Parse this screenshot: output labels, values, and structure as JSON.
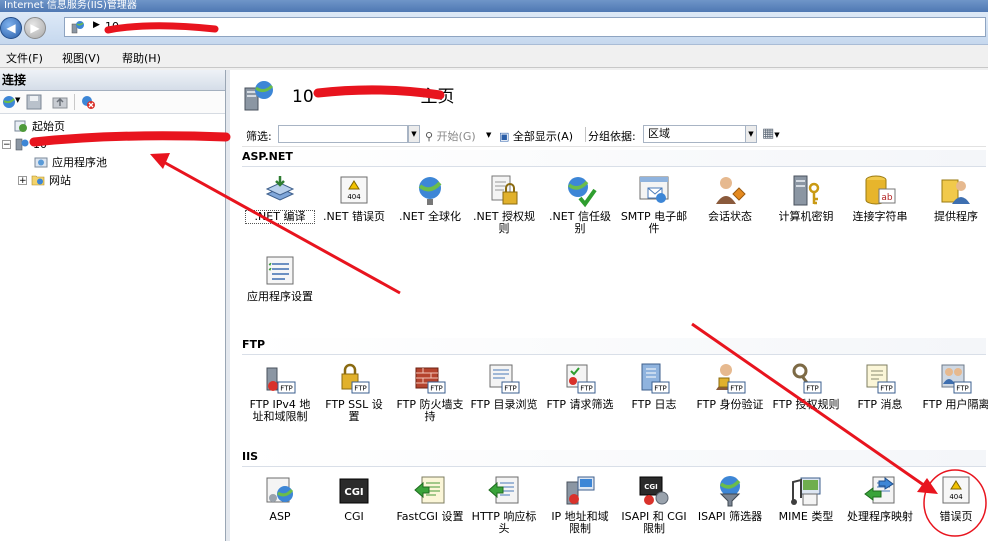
{
  "window": {
    "title": "Internet 信息服务(IIS)管理器"
  },
  "address": {
    "segment": "10"
  },
  "menu": {
    "items": [
      "文件(F)",
      "视图(V)",
      "帮助(H)"
    ]
  },
  "connections": {
    "title": "连接",
    "tree": {
      "start_page": "起始页",
      "server": "10",
      "app_pools": "应用程序池",
      "sites": "网站"
    }
  },
  "main": {
    "title_prefix": "10",
    "title_suffix": "主页",
    "filter": {
      "label": "筛选:",
      "start_label": "开始(G)",
      "show_all_label": "全部显示(A)",
      "group_label": "分组依据:",
      "group_value": "区域"
    },
    "sections": [
      {
        "title": "ASP.NET",
        "items": [
          ".NET 编译",
          ".NET 错误页",
          ".NET 全球化",
          ".NET 授权规则",
          ".NET 信任级别",
          "SMTP 电子邮件",
          "会话状态",
          "计算机密钥",
          "连接字符串",
          "提供程序",
          "应用程序设置"
        ]
      },
      {
        "title": "FTP",
        "items": [
          "FTP IPv4 地址和域限制",
          "FTP SSL 设置",
          "FTP 防火墙支持",
          "FTP 目录浏览",
          "FTP 请求筛选",
          "FTP 日志",
          "FTP 身份验证",
          "FTP 授权规则",
          "FTP 消息",
          "FTP 用户隔离"
        ]
      },
      {
        "title": "IIS",
        "items": [
          "ASP",
          "CGI",
          "FastCGI 设置",
          "HTTP 响应标头",
          "IP 地址和域限制",
          "ISAPI 和 CGI 限制",
          "ISAPI 筛选器",
          "MIME 类型",
          "处理程序映射",
          "错误页"
        ]
      }
    ],
    "icon_badges": {
      "ftp": "FTP",
      "error": "404",
      "cgi": "CGI"
    }
  },
  "colors": {
    "annotation": "#e8141e",
    "accent": "#2a5ea8"
  },
  "icons": {
    "app": "iis-server-globe-icon",
    "back": "arrow-left-icon",
    "forward": "arrow-right-icon"
  }
}
